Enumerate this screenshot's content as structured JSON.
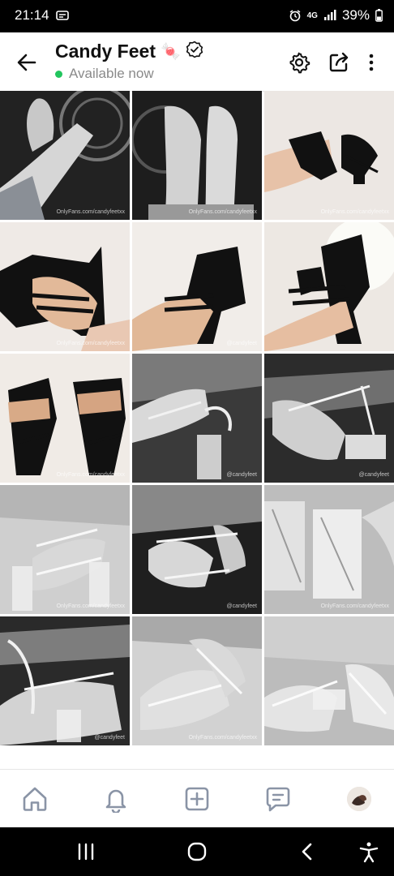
{
  "status_bar": {
    "time": "21:14",
    "network": "4G",
    "battery": "39%",
    "icons": [
      "message-icon",
      "alarm-icon",
      "signal-icon",
      "battery-icon"
    ]
  },
  "header": {
    "title": "Candy Feet",
    "title_emoji": "🍬",
    "availability": "Available now",
    "availability_color": "#22c55e",
    "icons": [
      "back-arrow-icon",
      "verified-icon",
      "settings-icon",
      "share-icon",
      "more-vertical-icon"
    ]
  },
  "media_grid": {
    "tiles": [
      {
        "label": "bw",
        "watermark": "OnlyFans.com/candyfeetxx"
      },
      {
        "label": "bw",
        "watermark": "OnlyFans.com/candyfeetxx"
      },
      {
        "label": "color",
        "watermark": "OnlyFans.com/candyfeetxx"
      },
      {
        "label": "color",
        "watermark": "OnlyFans.com/candyfeetxx"
      },
      {
        "label": "color",
        "watermark": "@candyfeet"
      },
      {
        "label": "color",
        "watermark": ""
      },
      {
        "label": "color",
        "watermark": "OnlyFans.com/candyfeetxx"
      },
      {
        "label": "bw",
        "watermark": "@candyfeet"
      },
      {
        "label": "bw",
        "watermark": "@candyfeet"
      },
      {
        "label": "bw",
        "watermark": "OnlyFans.com/candyfeetxx"
      },
      {
        "label": "bw",
        "watermark": "@candyfeet"
      },
      {
        "label": "bw",
        "watermark": "OnlyFans.com/candyfeetxx"
      },
      {
        "label": "bw",
        "watermark": "@candyfeet"
      },
      {
        "label": "bw",
        "watermark": "OnlyFans.com/candyfeetxx"
      },
      {
        "label": "bw",
        "watermark": ""
      }
    ]
  },
  "bottom_nav": {
    "items": [
      "home-icon",
      "bell-icon",
      "add-post-icon",
      "messages-icon",
      "avatar"
    ]
  },
  "system_nav": {
    "items": [
      "recent-apps-icon",
      "home-circle-icon",
      "back-chevron-icon",
      "accessibility-icon"
    ]
  }
}
